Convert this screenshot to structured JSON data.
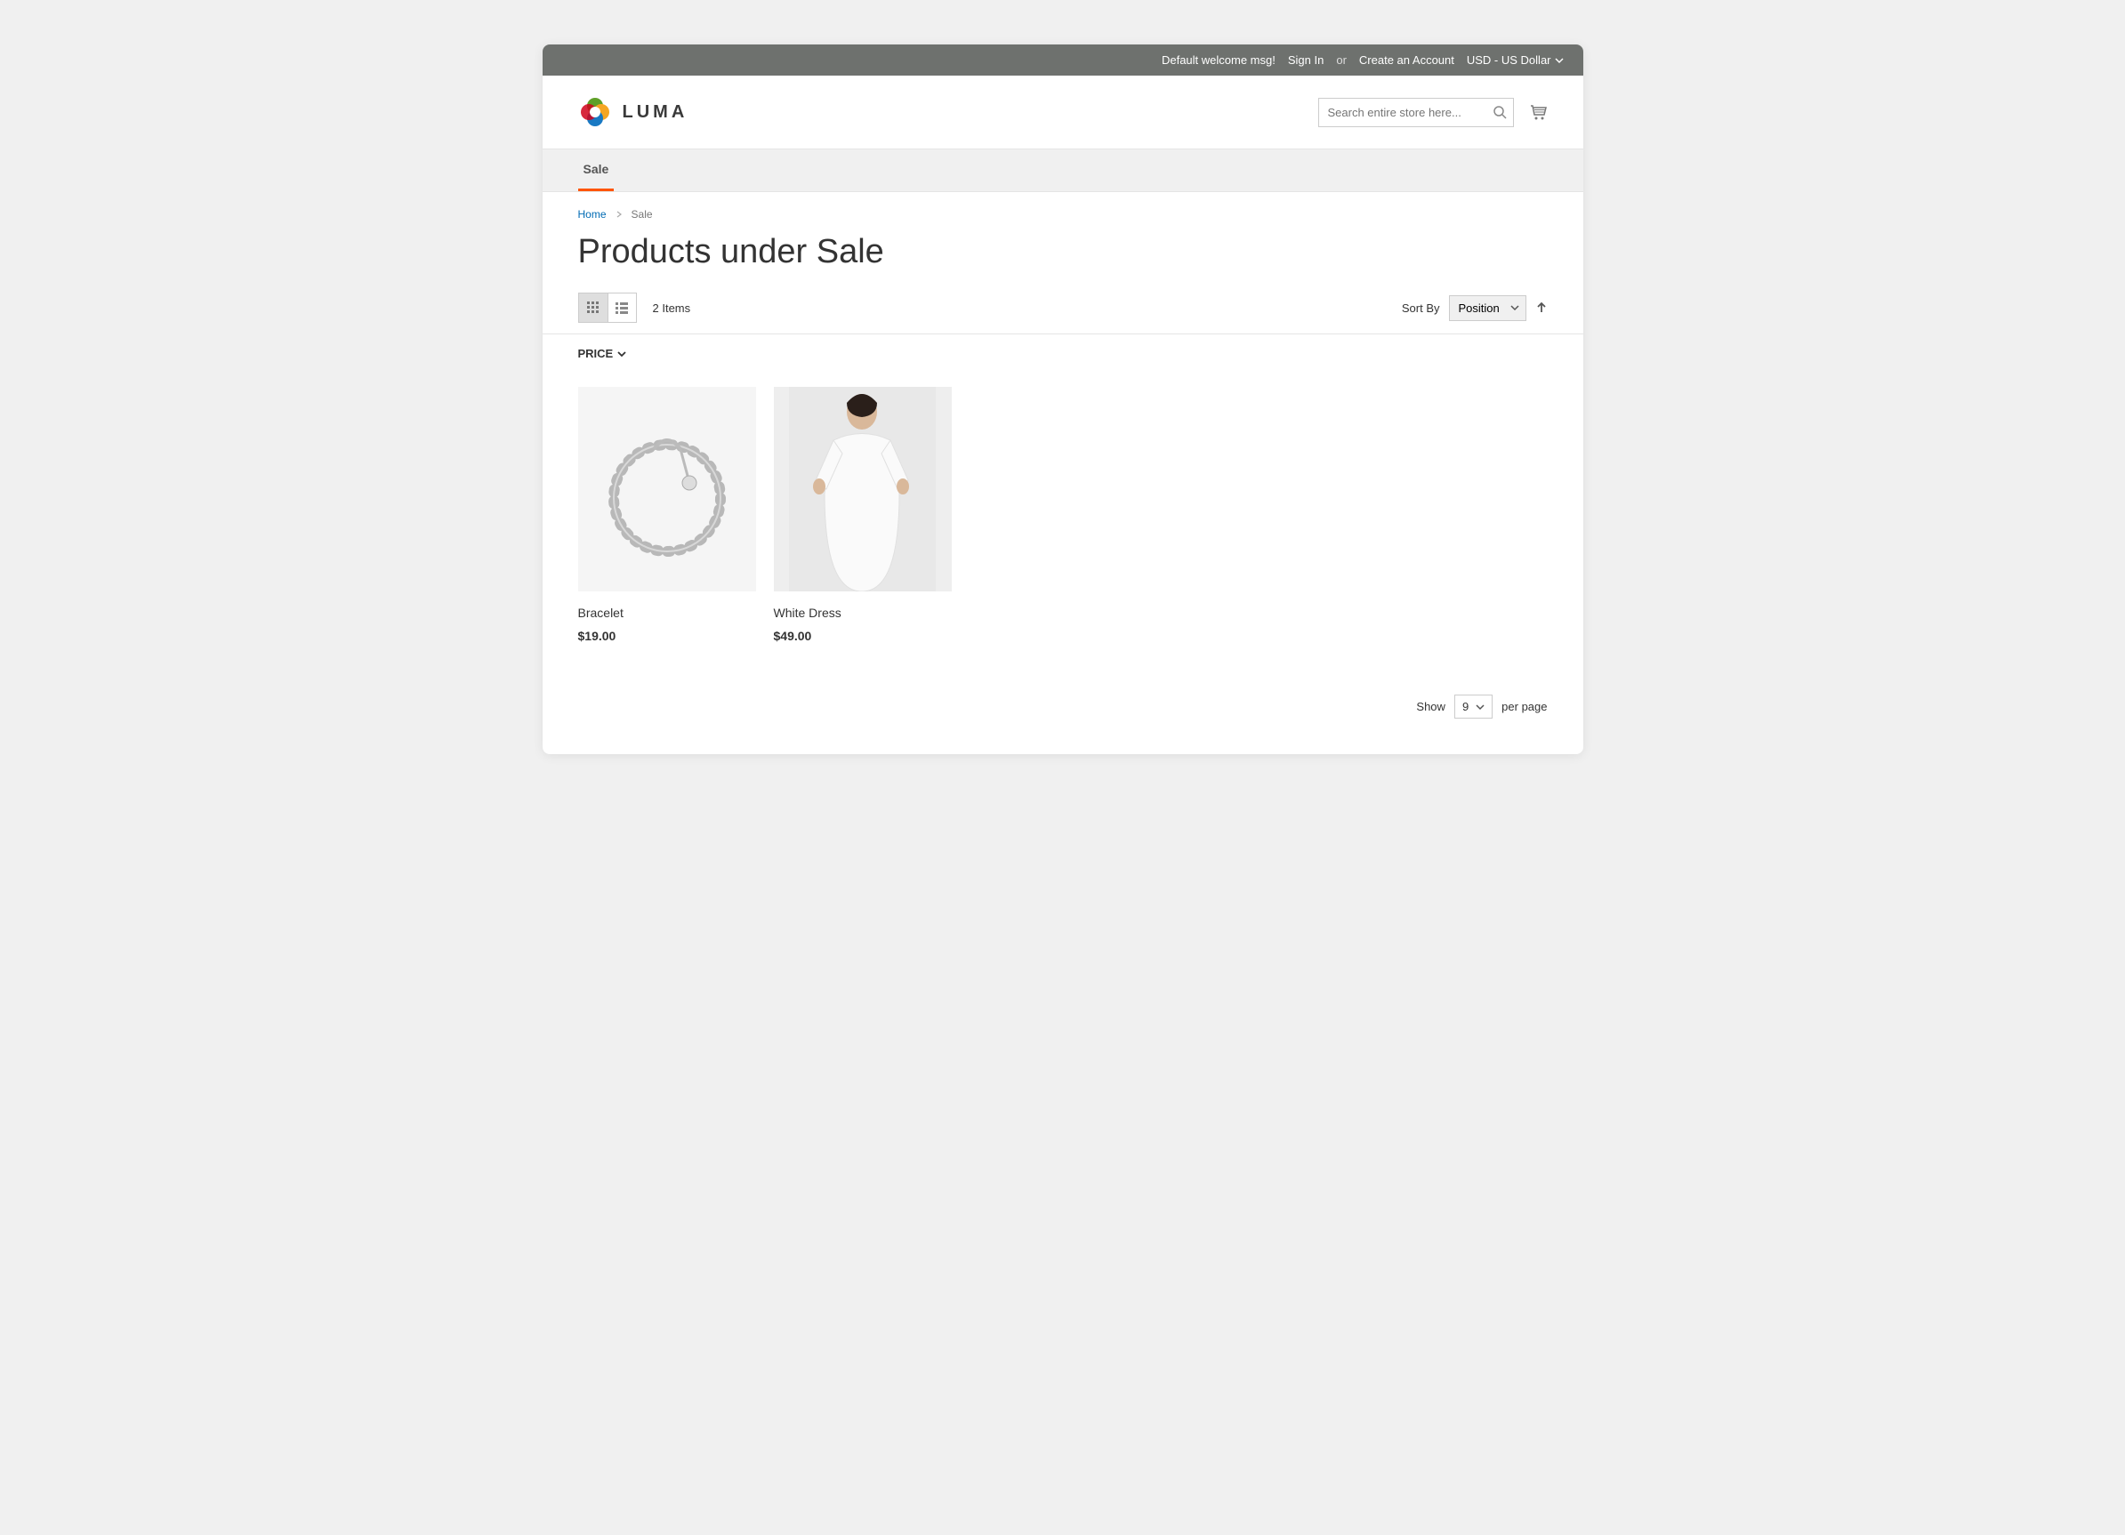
{
  "panel": {
    "welcome": "Default welcome msg!",
    "sign_in": "Sign In",
    "or": "or",
    "create_account": "Create an Account",
    "currency": "USD - US Dollar"
  },
  "header": {
    "logo_text": "LUMA",
    "search_placeholder": "Search entire store here..."
  },
  "nav": {
    "tab_sale": "Sale"
  },
  "breadcrumbs": {
    "home": "Home",
    "current": "Sale"
  },
  "page": {
    "title": "Products under Sale"
  },
  "toolbar": {
    "count_text": "2 Items",
    "sort_by_label": "Sort By",
    "sort_selected": "Position",
    "filter_label": "PRICE"
  },
  "products": [
    {
      "name": "Bracelet",
      "price": "$19.00"
    },
    {
      "name": "White Dress",
      "price": "$49.00"
    }
  ],
  "limiter": {
    "show_label": "Show",
    "value": "9",
    "per_page": "per page"
  }
}
